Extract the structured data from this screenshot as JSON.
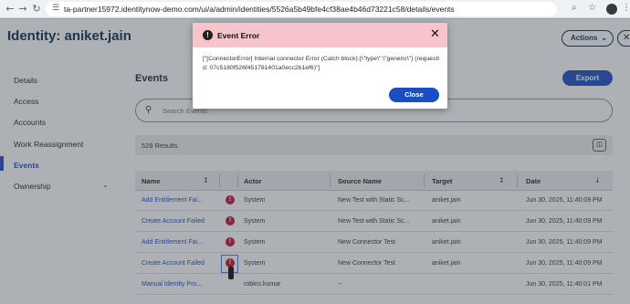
{
  "browser": {
    "url": "ta-partner15972.identitynow-demo.com/ui/a/admin/identities/5526a5b49bfe4cf38ae4b46d73221c58/details/events",
    "back_icon": "arrow-left-icon",
    "forward_icon": "arrow-right-icon",
    "reload_icon": "reload-icon"
  },
  "header": {
    "title": "Identity: aniket.jain",
    "actions_label": "Actions",
    "close_label": "✕"
  },
  "sidebar": {
    "items": [
      {
        "label": "Details"
      },
      {
        "label": "Access"
      },
      {
        "label": "Accounts"
      },
      {
        "label": "Work Reassignment"
      },
      {
        "label": "Events"
      },
      {
        "label": "Ownership"
      }
    ]
  },
  "main": {
    "section_title": "Events",
    "export_label": "Export",
    "search_placeholder": "Search Events",
    "results_label": "528 Results"
  },
  "table": {
    "headers": {
      "name": "Name",
      "actor": "Actor",
      "source": "Source Name",
      "target": "Target",
      "date": "Date"
    },
    "rows": [
      {
        "name": "Add Entitlement Fai...",
        "error": true,
        "actor": "System",
        "source": "New Test with Static Sc...",
        "target": "aniket.jain",
        "date": "Jun 30, 2025, 11:40:09 PM"
      },
      {
        "name": "Create Account Failed",
        "error": true,
        "actor": "System",
        "source": "New Test with Static Sc...",
        "target": "aniket.jain",
        "date": "Jun 30, 2025, 11:40:09 PM"
      },
      {
        "name": "Add Entitlement Fai...",
        "error": true,
        "actor": "System",
        "source": "New Connector Test",
        "target": "aniket.jain",
        "date": "Jun 30, 2025, 11:40:09 PM"
      },
      {
        "name": "Create Account Failed",
        "error": true,
        "actor": "System",
        "source": "New Connector Test",
        "target": "aniket.jain",
        "date": "Jun 30, 2025, 11:40:09 PM"
      },
      {
        "name": "Manual Identity Pro...",
        "error": false,
        "actor": "robins.kumar",
        "source": "--",
        "target": "",
        "date": "Jun 30, 2025, 11:40:01 PM"
      }
    ]
  },
  "modal": {
    "title": "Event Error",
    "message": "[\"[ConnectorError] Internal connector Error (Catch block):{\\\"type\\\":\\\"generic\\\"} (requestId: 07c5180f526f451781401a0ecc2b1ef6)\"]",
    "close_button": "Close",
    "close_icon": "✕"
  }
}
